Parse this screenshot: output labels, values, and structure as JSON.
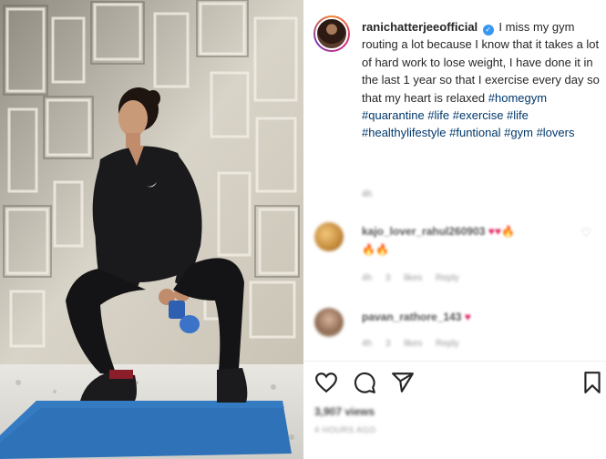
{
  "post": {
    "username": "ranichatterjeeofficial",
    "caption_text": "I miss my gym routing a lot because I know that it takes a lot of hard work to lose weight, I have done it in the last 1 year so that I exercise every day so that my heart is relaxed",
    "hashtags": [
      "#homegym",
      "#quarantine",
      "#life",
      "#exercise",
      "#life",
      "#healthylifestyle",
      "#funtional",
      "#gym",
      "#lovers"
    ],
    "time": "4h"
  },
  "comments": [
    {
      "user": "kajo_lover_rahul260903",
      "emoji": "♥♥🔥",
      "emoji2": "🔥🔥",
      "meta": "4h 3 likes Reply"
    },
    {
      "user": "pavan_rathore_143",
      "emoji": "♥",
      "meta": "4h 3 likes Reply"
    }
  ],
  "footer": {
    "views": "3,907 views",
    "ago": "4 HOURS AGO"
  },
  "icons": [
    "heart-icon",
    "comment-icon",
    "share-icon",
    "bookmark-icon",
    "verified-icon"
  ],
  "colors": {
    "hashtag": "#00376b",
    "verified": "#3897f0",
    "mat": "#2f72b8"
  }
}
